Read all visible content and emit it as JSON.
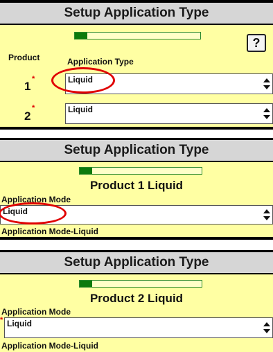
{
  "panel1": {
    "title": "Setup Application Type",
    "progress_percent": 10,
    "help_label": "?",
    "col_product": "Product",
    "col_app_type": "Application Type",
    "rows": [
      {
        "product": "1",
        "required_mark": "*",
        "value": "Liquid"
      },
      {
        "product": "2",
        "required_mark": "*",
        "value": "Liquid"
      }
    ]
  },
  "panel2": {
    "title": "Setup Application Type",
    "progress_percent": 10,
    "heading": "Product 1 Liquid",
    "mode_label": "Application Mode",
    "mode_value": "Liquid",
    "footer": "Application Mode-Liquid"
  },
  "panel3": {
    "title": "Setup Application Type",
    "progress_percent": 10,
    "heading": "Product 2 Liquid",
    "mode_label": "Application Mode",
    "required_mark": "*",
    "mode_value": "Liquid",
    "footer": "Application Mode-Liquid"
  },
  "colors": {
    "title_bar": "#d6d6d6",
    "panel_bg": "#ffffa3",
    "progress": "#0c7a0c",
    "highlight": "#e00000"
  }
}
